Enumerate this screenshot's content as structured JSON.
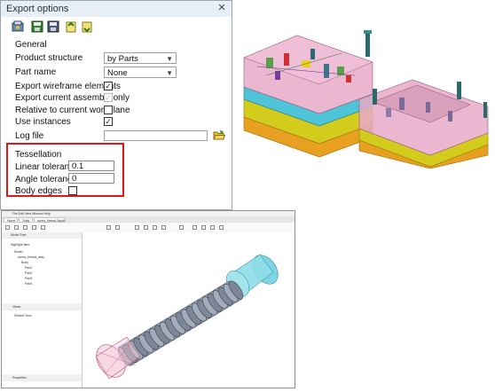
{
  "dialog": {
    "title": "Export options",
    "close_icon": "close-icon",
    "toolbar_icons": [
      "settings-icon",
      "save-icon",
      "save-as-icon",
      "load-icon",
      "export-icon"
    ],
    "general_label": "General",
    "product_structure": {
      "label": "Product structure",
      "value": "by Parts"
    },
    "part_name": {
      "label": "Part name",
      "value": "None"
    },
    "export_wireframe": {
      "label": "Export wireframe elements",
      "checked": true
    },
    "export_current_assembly": {
      "label": "Export current assembly only",
      "checked": true,
      "disabled": true
    },
    "relative_workplane": {
      "label": "Relative to current workplane",
      "checked": false
    },
    "use_instances": {
      "label": "Use instances",
      "checked": true
    },
    "log_file": {
      "label": "Log file",
      "value": "",
      "browse_icon": "folder-open-icon"
    },
    "tessellation": {
      "label": "Tessellation",
      "linear_tolerance": {
        "label": "Linear tolerance",
        "value": "0.1"
      },
      "angle_tolerance": {
        "label": "Angle tolerance",
        "value": "0"
      },
      "body_edges": {
        "label": "Body edges",
        "checked": false
      }
    },
    "highlight_color": "#e01818"
  },
  "viewer": {
    "menu": "File  Edit  View  Window  Help",
    "tabs": [
      "Home",
      "Tools",
      "screw_thread.3dpdf"
    ],
    "tree_header": "Model Tree",
    "tree_items": [
      "Highlight Item",
      "Model",
      "screw_thread_assy",
      "Body",
      "Part1",
      "Part2",
      "Part3",
      "Part4"
    ],
    "sub_header": "Views",
    "sub_items": [
      "Default View"
    ],
    "props_header": "Properties"
  },
  "colors": {
    "mold_top": "#e8a9c8",
    "cyan_plate": "#4fc4d8",
    "yellow_plate": "#d4cc1c",
    "orange_plate": "#e8a020",
    "part_cyan": "#7fd6e2",
    "part_gray": "#8d97a8"
  }
}
